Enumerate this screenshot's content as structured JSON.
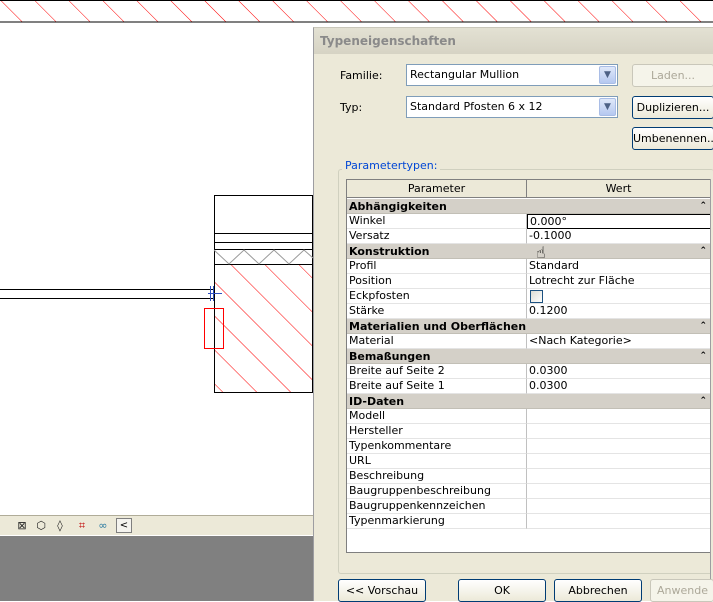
{
  "canvas": {
    "toolbar": {
      "icons": [
        "detail-level-icon",
        "visual-style-icon",
        "sun-path-icon",
        "crop-icon",
        "temporary-hide-icon",
        "scroll-left-icon"
      ]
    }
  },
  "dialog": {
    "title": "Typeneigenschaften",
    "familie_label": "Familie:",
    "familie_value": "Rectangular Mullion",
    "typ_label": "Typ:",
    "typ_value": "Standard Pfosten 6 x 12",
    "laden_button": "Laden...",
    "duplizieren_button": "Duplizieren...",
    "umbenennen_button": "Umbenennen...",
    "group_title": "Parametertypen:",
    "grid": {
      "header_parameter": "Parameter",
      "header_wert": "Wert",
      "groups": [
        {
          "name": "Abhängigkeiten",
          "rows": [
            {
              "name": "Winkel",
              "value": "0.000°"
            },
            {
              "name": "Versatz",
              "value": "-0.1000"
            }
          ]
        },
        {
          "name": "Konstruktion",
          "rows": [
            {
              "name": "Profil",
              "value": "Standard"
            },
            {
              "name": "Position",
              "value": "Lotrecht zur Fläche"
            },
            {
              "name": "Eckpfosten",
              "value": ""
            },
            {
              "name": "Stärke",
              "value": "0.1200"
            }
          ]
        },
        {
          "name": "Materialien und Oberflächen",
          "rows": [
            {
              "name": "Material",
              "value": "<Nach Kategorie>"
            }
          ]
        },
        {
          "name": "Bemaßungen",
          "rows": [
            {
              "name": "Breite auf Seite 2",
              "value": "0.0300"
            },
            {
              "name": "Breite auf Seite 1",
              "value": "0.0300"
            }
          ]
        },
        {
          "name": "ID-Daten",
          "rows": [
            {
              "name": "Modell",
              "value": ""
            },
            {
              "name": "Hersteller",
              "value": ""
            },
            {
              "name": "Typenkommentare",
              "value": ""
            },
            {
              "name": "URL",
              "value": ""
            },
            {
              "name": "Beschreibung",
              "value": ""
            },
            {
              "name": "Baugruppenbeschreibung",
              "value": ""
            },
            {
              "name": "Baugruppenkennzeichen",
              "value": ""
            },
            {
              "name": "Typenmarkierung",
              "value": ""
            }
          ]
        }
      ]
    },
    "vorschau_button": "<< Vorschau",
    "ok_button": "OK",
    "abbrechen_button": "Abbrechen",
    "anwenden_button": "Anwende"
  },
  "colors": {
    "hatch": "#ff0000",
    "dialog_bg": "#ece9d8",
    "group_header_bg": "#d4d0c8",
    "link_blue": "#0046d5"
  }
}
